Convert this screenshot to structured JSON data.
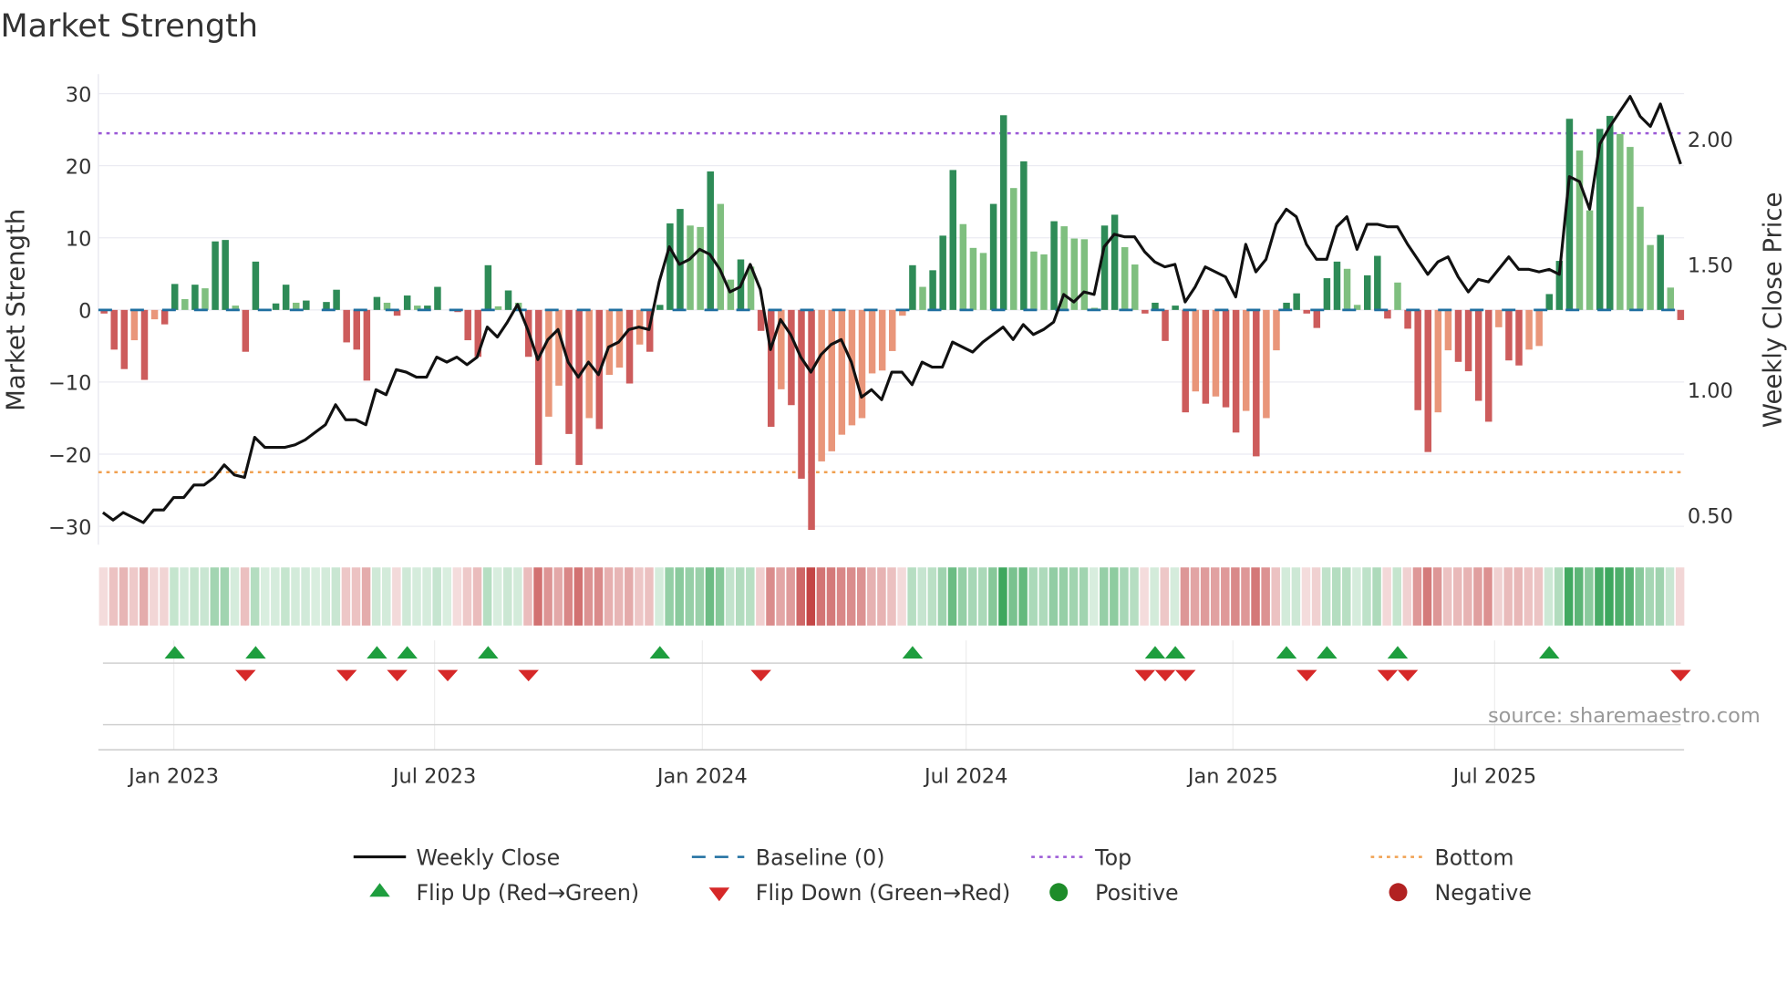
{
  "chart_data": {
    "type": "bar",
    "title": "Market Strength",
    "ylabel": "Market Strength",
    "y2label": "Weekly Close Price",
    "ylim": [
      -33,
      33
    ],
    "y2lim": [
      0.41,
      2.25
    ],
    "yticks": [
      30,
      20,
      10,
      0,
      -10,
      -20,
      -30
    ],
    "yticklabels": [
      "30",
      "20",
      "10",
      "0",
      "−10",
      "−20",
      "−30"
    ],
    "y2ticks": [
      2.0,
      1.5,
      1.0,
      0.5
    ],
    "y2ticklabels": [
      "2.00",
      "1.50",
      "1.00",
      "0.50"
    ],
    "xticks": [
      {
        "label": "Jan 2023",
        "week_index": 6.9
      },
      {
        "label": "Jul 2023",
        "week_index": 32.7
      },
      {
        "label": "Jan 2024",
        "week_index": 59.2
      },
      {
        "label": "Jul 2024",
        "week_index": 85.3
      },
      {
        "label": "Jan 2025",
        "week_index": 111.7
      },
      {
        "label": "Jul 2025",
        "week_index": 137.6
      }
    ],
    "top_level": 24.5,
    "bottom_level": -22.5,
    "baseline": 0,
    "strength": [
      -0.5,
      -5.5,
      -8.2,
      -4.2,
      -9.7,
      -1.3,
      -2,
      3.6,
      1.5,
      3.5,
      3,
      9.5,
      9.7,
      0.6,
      -5.8,
      6.7,
      0,
      0.9,
      3.5,
      1,
      1.3,
      0,
      1.1,
      2.8,
      -4.5,
      -5.5,
      -9.8,
      1.8,
      1,
      -0.8,
      2,
      0.6,
      0.6,
      3.2,
      0,
      -0.3,
      -4.2,
      -6.5,
      6.2,
      0.5,
      2.7,
      1,
      -6.5,
      -21.5,
      -14.8,
      -10.5,
      -17.2,
      -21.5,
      -15,
      -16.5,
      -9,
      -8,
      -10.2,
      -4.8,
      -5.8,
      0.7,
      12,
      14,
      11.7,
      11.5,
      19.2,
      14.7,
      4.2,
      7,
      6,
      -2.9,
      -16.2,
      -11,
      -13.2,
      -23.4,
      -30.5,
      -21,
      -19.6,
      -17.3,
      -16,
      -15,
      -8.8,
      -8.4,
      -5.7,
      -0.8,
      6.2,
      3.2,
      5.5,
      10.3,
      19.4,
      11.9,
      8.6,
      7.9,
      14.7,
      27,
      16.9,
      20.6,
      8.1,
      7.7,
      12.3,
      11.6,
      9.9,
      9.8,
      0.3,
      11.7,
      13.2,
      8.7,
      6.3,
      -0.5,
      1,
      -4.3,
      0.6,
      -14.2,
      -11.3,
      -13,
      -12,
      -13.5,
      -17,
      -14,
      -20.3,
      -15,
      -5.6,
      1,
      2.3,
      -0.5,
      -2.5,
      4.4,
      6.7,
      5.7,
      0.7,
      4.8,
      7.5,
      -1.2,
      3.8,
      -2.6,
      -13.9,
      -19.7,
      -14.2,
      -5.6,
      -7.2,
      -8.5,
      -12.6,
      -15.5,
      -2.4,
      -7,
      -7.7,
      -5.5,
      -5,
      2.2,
      6.8,
      26.5,
      22.1,
      13.8,
      25.1,
      26.9,
      24.4,
      22.6,
      14.3,
      9,
      10.4,
      3.1,
      -1.4
    ],
    "shade": [
      "d",
      "d",
      "d",
      "l",
      "d",
      "l",
      "d",
      "d",
      "l",
      "d",
      "l",
      "d",
      "d",
      "l",
      "d",
      "d",
      "d",
      "d",
      "d",
      "l",
      "d",
      "l",
      "d",
      "d",
      "d",
      "d",
      "d",
      "d",
      "l",
      "d",
      "d",
      "l",
      "d",
      "d",
      "l",
      "d",
      "d",
      "d",
      "d",
      "l",
      "d",
      "l",
      "d",
      "d",
      "l",
      "l",
      "d",
      "d",
      "l",
      "d",
      "l",
      "l",
      "d",
      "l",
      "d",
      "d",
      "d",
      "d",
      "l",
      "l",
      "d",
      "l",
      "l",
      "d",
      "l",
      "d",
      "d",
      "l",
      "d",
      "d",
      "d",
      "l",
      "l",
      "l",
      "l",
      "l",
      "l",
      "l",
      "l",
      "l",
      "d",
      "l",
      "d",
      "d",
      "d",
      "l",
      "l",
      "l",
      "d",
      "d",
      "l",
      "d",
      "l",
      "l",
      "d",
      "l",
      "l",
      "l",
      "l",
      "d",
      "d",
      "l",
      "l",
      "d",
      "d",
      "d",
      "d",
      "d",
      "l",
      "d",
      "l",
      "d",
      "d",
      "l",
      "d",
      "l",
      "l",
      "d",
      "d",
      "d",
      "d",
      "d",
      "d",
      "l",
      "l",
      "d",
      "d",
      "d",
      "l",
      "d",
      "d",
      "d",
      "l",
      "l",
      "d",
      "d",
      "d",
      "d",
      "l",
      "d",
      "d",
      "l",
      "l",
      "d",
      "d",
      "d",
      "l",
      "l",
      "d",
      "d",
      "l",
      "l",
      "l",
      "l",
      "d",
      "l",
      "d"
    ],
    "weekly_close": [
      0.51,
      0.48,
      0.51,
      0.49,
      0.47,
      0.52,
      0.52,
      0.57,
      0.57,
      0.62,
      0.62,
      0.65,
      0.7,
      0.66,
      0.65,
      0.81,
      0.77,
      0.77,
      0.77,
      0.78,
      0.8,
      0.83,
      0.86,
      0.94,
      0.88,
      0.88,
      0.86,
      1.0,
      0.98,
      1.08,
      1.07,
      1.05,
      1.05,
      1.13,
      1.11,
      1.13,
      1.1,
      1.13,
      1.25,
      1.21,
      1.27,
      1.34,
      1.24,
      1.12,
      1.2,
      1.24,
      1.11,
      1.05,
      1.11,
      1.06,
      1.17,
      1.19,
      1.24,
      1.25,
      1.24,
      1.43,
      1.57,
      1.5,
      1.52,
      1.56,
      1.54,
      1.48,
      1.39,
      1.41,
      1.5,
      1.4,
      1.16,
      1.28,
      1.22,
      1.13,
      1.07,
      1.14,
      1.18,
      1.2,
      1.11,
      0.97,
      1.0,
      0.96,
      1.07,
      1.07,
      1.02,
      1.11,
      1.09,
      1.09,
      1.19,
      1.17,
      1.15,
      1.19,
      1.22,
      1.25,
      1.2,
      1.26,
      1.22,
      1.24,
      1.27,
      1.38,
      1.35,
      1.39,
      1.38,
      1.57,
      1.62,
      1.61,
      1.61,
      1.55,
      1.51,
      1.49,
      1.5,
      1.35,
      1.41,
      1.49,
      1.47,
      1.45,
      1.37,
      1.58,
      1.47,
      1.52,
      1.66,
      1.72,
      1.69,
      1.58,
      1.52,
      1.52,
      1.65,
      1.69,
      1.56,
      1.66,
      1.66,
      1.65,
      1.65,
      1.58,
      1.52,
      1.46,
      1.51,
      1.53,
      1.45,
      1.39,
      1.44,
      1.43,
      1.48,
      1.53,
      1.48,
      1.48,
      1.47,
      1.48,
      1.46,
      1.85,
      1.83,
      1.72,
      1.98,
      2.05,
      2.11,
      2.17,
      2.09,
      2.05,
      2.14,
      2.02,
      1.9
    ],
    "flip_up_weeks": [
      7,
      15,
      27,
      30,
      38,
      55,
      80,
      104,
      106,
      117,
      121,
      128,
      143
    ],
    "flip_down_weeks": [
      14,
      24,
      29,
      34,
      42,
      65,
      103,
      105,
      107,
      119,
      127,
      129,
      156
    ],
    "legend": {
      "placement": "bottom",
      "items": [
        {
          "label": "Weekly Close"
        },
        {
          "label": "Baseline (0)"
        },
        {
          "label": "Top"
        },
        {
          "label": "Bottom"
        },
        {
          "label": "Flip Up (Red→Green)"
        },
        {
          "label": "Flip Down (Green→Red)"
        },
        {
          "label": "Positive"
        },
        {
          "label": "Negative"
        }
      ]
    },
    "source": "source: sharemaestro.com",
    "colors": {
      "strong_pos": "#2e8b57",
      "weak_pos": "#7fbf7f",
      "strong_neg": "#cd5c5c",
      "weak_neg": "#e9967a",
      "line": "#111111",
      "baseline": "#1f6fa0",
      "top": "#9b59d6",
      "bottom": "#f0a050",
      "flip_up": "#1e9e3e",
      "flip_down": "#d62828",
      "positive": "#1e8c2a",
      "negative": "#b22222"
    }
  }
}
